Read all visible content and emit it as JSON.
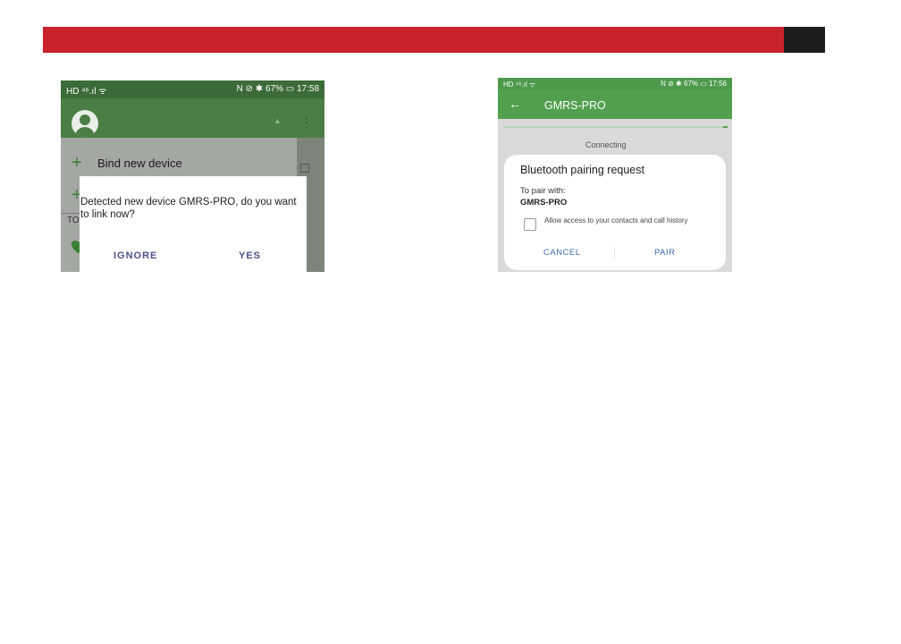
{
  "left_screen": {
    "status_left": "HD ⁴⁶.ıl ᯤ",
    "status_right": "N ⊘ ✱ 67% ▭ 17:58",
    "bind_label": "Bind new device",
    "plus_glyph": "+",
    "section_prefix": "TO",
    "dialog_message": "Detected new device GMRS-PRO, do you want to link now?",
    "ignore_label": "IGNORE",
    "yes_label": "YES",
    "accent": "#4a7e44"
  },
  "right_screen": {
    "status_left": "HD ⁴⁶.ıl ᯤ",
    "status_right": "N ⊘ ✱ 67% ▭ 17:56",
    "back_glyph": "←",
    "title": "GMRS-PRO",
    "connecting_text": "Connecting",
    "dialog_title": "Bluetooth pairing request",
    "to_pair_with": "To pair with:",
    "device_name": "GMRS-PRO",
    "allow_access_text": "Allow access to your contacts and call history",
    "cancel_label": "CANCEL",
    "pair_label": "PAIR",
    "accent": "#52a04f",
    "button_color": "#3c6bb0"
  },
  "header": {
    "bar_color": "#c8232b",
    "block_color": "#1c1c1c"
  }
}
